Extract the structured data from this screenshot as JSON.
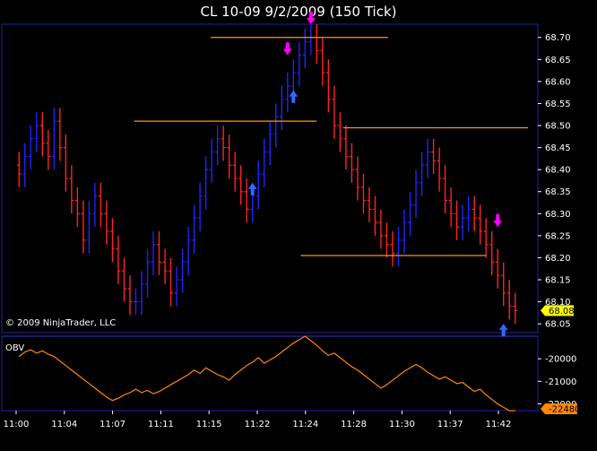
{
  "window": {
    "title": "CL 10-09  9/2/2009 (150 Tick)",
    "copyright": "© 2009 NinjaTrader, LLC"
  },
  "colors": {
    "background": "#000000",
    "up_bar": "#2222ff",
    "down_bar": "#ff2222",
    "panel_border": "#2222aa",
    "hline": "#ff9900",
    "obv_line": "#ff8800",
    "signal": "#ff00ff",
    "signal_up": "#3366ff",
    "price_tag": "#ffff00"
  },
  "chart_data": [
    {
      "type": "bar",
      "panel": "price",
      "ylim": [
        68.03,
        68.73
      ],
      "yticks": [
        "68.70",
        "68.65",
        "68.60",
        "68.55",
        "68.50",
        "68.45",
        "68.40",
        "68.35",
        "68.30",
        "68.25",
        "68.20",
        "68.15",
        "68.10",
        "68.05"
      ],
      "last_price": "68.08",
      "xticks": [
        "11:00",
        "11:04",
        "11:07",
        "11:11",
        "11:15",
        "11:22",
        "11:24",
        "11:28",
        "11:30",
        "11:37",
        "11:42"
      ],
      "series": [
        {
          "values": [
            68.39,
            68.43,
            68.47,
            68.5,
            68.46,
            68.43,
            68.51,
            68.45,
            68.38,
            68.33,
            68.3,
            68.24,
            68.3,
            68.34,
            68.3,
            68.26,
            68.22,
            68.17,
            68.13,
            68.1,
            68.1,
            68.14,
            68.19,
            68.23,
            68.19,
            68.17,
            68.12,
            68.15,
            68.19,
            68.24,
            68.29,
            68.34,
            68.4,
            68.44,
            68.47,
            68.45,
            68.41,
            68.38,
            68.35,
            68.31,
            68.34,
            68.39,
            68.44,
            68.48,
            68.52,
            68.56,
            68.59,
            68.62,
            68.66,
            68.69,
            68.7,
            68.67,
            68.62,
            68.56,
            68.5,
            68.47,
            68.43,
            68.4,
            68.36,
            68.33,
            68.31,
            68.28,
            68.25,
            68.23,
            68.21,
            68.24,
            68.28,
            68.32,
            68.37,
            68.41,
            68.44,
            68.42,
            68.38,
            68.33,
            68.3,
            68.27,
            68.29,
            68.31,
            68.29,
            68.26,
            68.23,
            68.19,
            68.16,
            68.12,
            68.09,
            68.08
          ]
        }
      ],
      "horizontal_levels": [
        {
          "price": 68.7,
          "x_from": 0.385,
          "x_to": 0.72
        },
        {
          "price": 68.51,
          "x_from": 0.24,
          "x_to": 0.585
        },
        {
          "price": 68.495,
          "x_from": 0.635,
          "x_to": 0.985
        },
        {
          "price": 68.205,
          "x_from": 0.555,
          "x_to": 0.905
        }
      ]
    },
    {
      "type": "line",
      "panel": "OBV",
      "title": "OBV",
      "ylim": [
        -22300,
        -19000
      ],
      "yticks": [
        "-20000",
        "-21000",
        "-22000"
      ],
      "last_value": "-22480",
      "series": [
        {
          "name": "OBV",
          "values": [
            -19900,
            -19700,
            -19600,
            -19750,
            -19650,
            -19800,
            -19900,
            -20100,
            -20300,
            -20500,
            -20700,
            -20900,
            -21100,
            -21300,
            -21500,
            -21700,
            -21850,
            -21750,
            -21600,
            -21500,
            -21350,
            -21500,
            -21400,
            -21550,
            -21450,
            -21300,
            -21150,
            -21000,
            -20850,
            -20700,
            -20500,
            -20650,
            -20400,
            -20550,
            -20700,
            -20800,
            -20950,
            -20700,
            -20500,
            -20300,
            -20150,
            -19950,
            -20200,
            -20050,
            -19900,
            -19700,
            -19500,
            -19300,
            -19150,
            -19000,
            -19200,
            -19400,
            -19650,
            -19850,
            -19750,
            -19950,
            -20150,
            -20350,
            -20500,
            -20700,
            -20900,
            -21100,
            -21300,
            -21150,
            -20950,
            -20750,
            -20550,
            -20400,
            -20250,
            -20400,
            -20600,
            -20750,
            -20900,
            -20800,
            -20950,
            -21100,
            -21050,
            -21250,
            -21450,
            -21350,
            -21600,
            -21800,
            -22000,
            -22150,
            -22300,
            -22480
          ]
        }
      ]
    }
  ]
}
